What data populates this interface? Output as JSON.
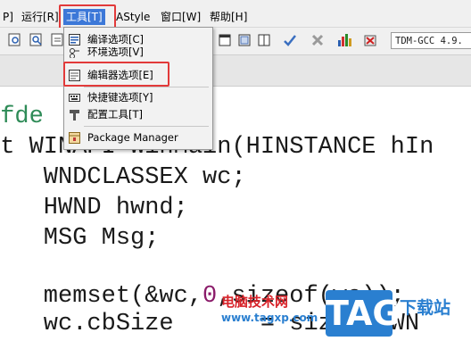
{
  "menubar": {
    "items": [
      {
        "label": "P]",
        "key": "project"
      },
      {
        "label": "运行[R]",
        "key": "run"
      },
      {
        "label": "工具[T]",
        "key": "tools"
      },
      {
        "label": "AStyle",
        "key": "astyle"
      },
      {
        "label": "窗口[W]",
        "key": "window"
      },
      {
        "label": "帮助[H]",
        "key": "help"
      }
    ],
    "active": "工具[T]",
    "highlight_color": "#3c78d8",
    "annotation_color": "#e23a3a"
  },
  "toolbar": {
    "compiler": "TDM-GCC 4.9."
  },
  "tools_menu": {
    "items": [
      {
        "label": "编译选项[C]",
        "icon": "compiler-options-icon"
      },
      {
        "label": "环境选项[V]",
        "icon": "environment-options-icon"
      },
      {
        "label": "编辑器选项[E]",
        "icon": "editor-options-icon"
      },
      {
        "label": "快捷键选项[Y]",
        "icon": "shortcut-keys-icon"
      },
      {
        "label": "配置工具[T]",
        "icon": "configure-tools-icon"
      },
      {
        "label": "Package Manager",
        "icon": "package-manager-icon"
      }
    ]
  },
  "editor": {
    "lines": [
      "ifde",
      "nt WINAPI WinMain(HINSTANCE hIn",
      "    WNDCLASSEX wc;",
      "    HWND hwnd;",
      "    MSG Msg;",
      "",
      "    memset(&wc,0,sizeof(wc));",
      "    wc.cbSize      = sizeof(WN"
    ]
  },
  "watermark": {
    "site_name": "电脑技术网",
    "url": "www.tagxp.com",
    "tag": "TAG",
    "download": "下载站"
  }
}
